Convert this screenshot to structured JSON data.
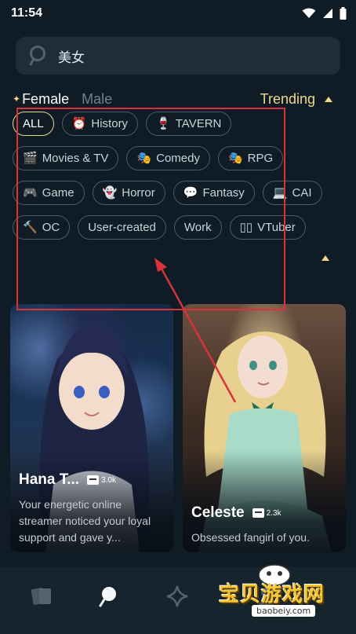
{
  "status_bar": {
    "time": "11:54",
    "icons": [
      "wifi-icon",
      "signal-icon",
      "battery-icon"
    ]
  },
  "search": {
    "value": "美女",
    "icon": "search-icon"
  },
  "filters": {
    "female_label": "Female",
    "male_label": "Male",
    "sort_label": "Trending",
    "selected_gender": "Female"
  },
  "tags": [
    {
      "icon": "",
      "label": "ALL",
      "active": true
    },
    {
      "icon": "⏰",
      "label": "History"
    },
    {
      "icon": "🍷",
      "label": "TAVERN"
    },
    {
      "icon": "🎬",
      "label": "Movies & TV"
    },
    {
      "icon": "🎭",
      "label": "Comedy"
    },
    {
      "icon": "🎭",
      "label": "RPG"
    },
    {
      "icon": "🎮",
      "label": "Game"
    },
    {
      "icon": "👻",
      "label": "Horror"
    },
    {
      "icon": "💬",
      "label": "Fantasy"
    },
    {
      "icon": "💻",
      "label": "CAI"
    },
    {
      "icon": "🔨",
      "label": "OC"
    },
    {
      "icon": "",
      "label": "User-created"
    },
    {
      "icon": "",
      "label": "Work"
    },
    {
      "icon": "▯▯",
      "label": "VTuber"
    }
  ],
  "cards": [
    {
      "name": "Hana T...",
      "count": "3.0k",
      "description": "Your energetic online streamer noticed your loyal support and gave y..."
    },
    {
      "name": "Celeste",
      "count": "2.3k",
      "description": "Obsessed fangirl of you."
    }
  ],
  "bottom_nav": {
    "items": [
      "cards-icon",
      "search-icon",
      "sparkle-icon",
      "profile-icon"
    ]
  },
  "watermark": {
    "text": "宝贝游戏网",
    "url": "baobeiy.com"
  },
  "colors": {
    "background": "#0f1c26",
    "accent": "#f0d889",
    "annotation": "#d8323a"
  }
}
